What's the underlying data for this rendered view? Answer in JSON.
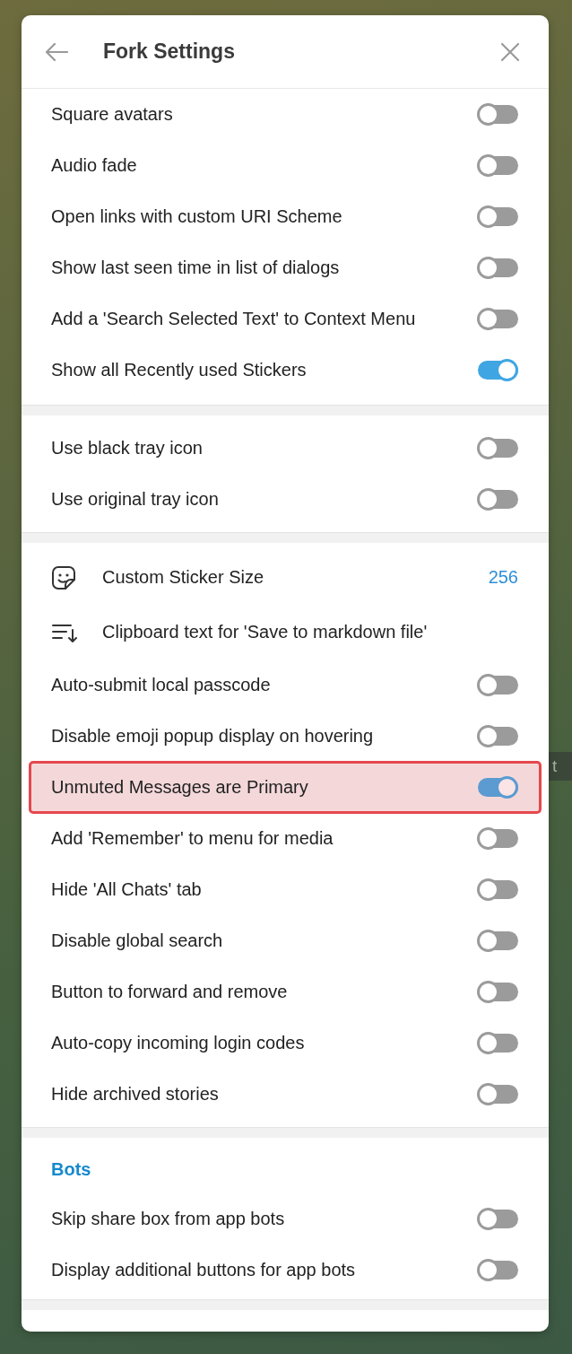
{
  "background": {
    "hint_fragment": "t"
  },
  "dialog": {
    "title": "Fork Settings"
  },
  "sections": [
    {
      "rows": [
        {
          "kind": "toggle",
          "label": "Square avatars",
          "on": false,
          "highlighted": false
        },
        {
          "kind": "toggle",
          "label": "Audio fade",
          "on": false,
          "highlighted": false
        },
        {
          "kind": "toggle",
          "label": "Open links with custom URI Scheme",
          "on": false,
          "highlighted": false
        },
        {
          "kind": "toggle",
          "label": "Show last seen time in list of dialogs",
          "on": false,
          "highlighted": false
        },
        {
          "kind": "toggle",
          "label": "Add a 'Search Selected Text' to Context Menu",
          "on": false,
          "highlighted": false
        },
        {
          "kind": "toggle",
          "label": "Show all Recently used Stickers",
          "on": true,
          "highlighted": false
        }
      ]
    },
    {
      "rows": [
        {
          "kind": "toggle",
          "label": "Use black tray icon",
          "on": false,
          "highlighted": false
        },
        {
          "kind": "toggle",
          "label": "Use original tray icon",
          "on": false,
          "highlighted": false
        }
      ]
    },
    {
      "rows": [
        {
          "kind": "value",
          "label": "Custom Sticker Size",
          "value": "256",
          "highlighted": false
        },
        {
          "kind": "action",
          "label": "Clipboard text for 'Save to markdown file'",
          "highlighted": false
        },
        {
          "kind": "toggle",
          "label": "Auto-submit local passcode",
          "on": false,
          "highlighted": false
        },
        {
          "kind": "toggle",
          "label": "Disable emoji popup display on hovering",
          "on": false,
          "highlighted": false
        },
        {
          "kind": "toggle",
          "label": "Unmuted Messages are Primary",
          "on": true,
          "highlighted": true
        },
        {
          "kind": "toggle",
          "label": "Add 'Remember' to menu for media",
          "on": false,
          "highlighted": false
        },
        {
          "kind": "toggle",
          "label": "Hide 'All Chats' tab",
          "on": false,
          "highlighted": false
        },
        {
          "kind": "toggle",
          "label": "Disable global search",
          "on": false,
          "highlighted": false
        },
        {
          "kind": "toggle",
          "label": "Button to forward and remove",
          "on": false,
          "highlighted": false
        },
        {
          "kind": "toggle",
          "label": "Auto-copy incoming login codes",
          "on": false,
          "highlighted": false
        },
        {
          "kind": "toggle",
          "label": "Hide archived stories",
          "on": false,
          "highlighted": false
        }
      ]
    },
    {
      "header": "Bots",
      "rows": [
        {
          "kind": "toggle",
          "label": "Skip share box from app bots",
          "on": false,
          "highlighted": false
        },
        {
          "kind": "toggle",
          "label": "Display additional buttons for app bots",
          "on": false,
          "highlighted": false
        }
      ]
    }
  ]
}
